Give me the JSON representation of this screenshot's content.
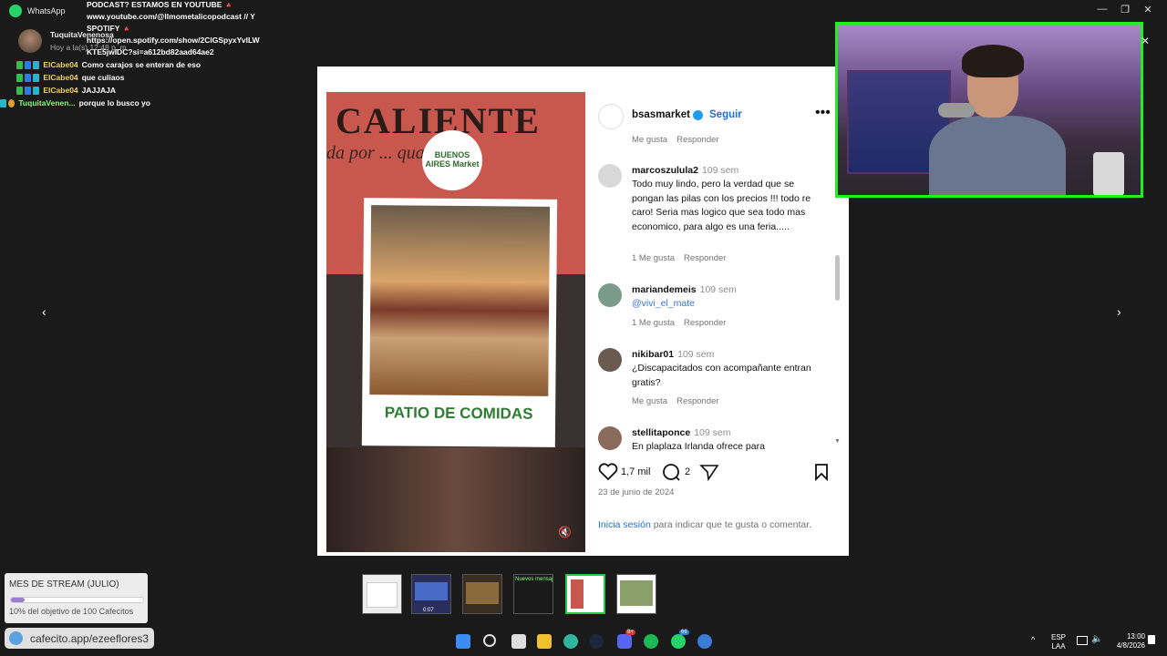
{
  "window": {
    "title": "WhatsApp",
    "minimize": "—",
    "restore": "❐",
    "close": "✕"
  },
  "overlay_top": {
    "line1": "PODCAST? ESTAMOS EN YOUTUBE 🔺",
    "line2": "www.youtube.com/@llmometalicopodcast // Y",
    "line3": "SPOTIFY 🔺",
    "line4": "https://open.spotify.com/show/2ClGSpyxYvlLW",
    "line5": "KTE5jwIDC?si=a612bd82aad64ae2",
    "contact_name": "TuquitaVenenosa",
    "contact_time": "Hoy a la(s) 12:48 p. m."
  },
  "chat": [
    {
      "user": "ElCabe04",
      "text": "Como carajos se enteran de eso"
    },
    {
      "user": "ElCabe04",
      "text": "que culiaos"
    },
    {
      "user": "ElCabe04",
      "text": "JAJJAJA"
    },
    {
      "user": "TuquitaVenen...",
      "text": "porque lo busco yo"
    }
  ],
  "post": {
    "image_heading": "CALIENTE",
    "image_sub": "da por ... qualable c",
    "logo_text": "BUENOS AIRES Market",
    "caption": "PATIO DE COMIDAS",
    "mute_icon": "🔇"
  },
  "header": {
    "user": "bsasmarket",
    "follow": "Seguir",
    "more": "•••"
  },
  "top_partial": {
    "likes": "Me gusta",
    "reply": "Responder"
  },
  "comments": [
    {
      "user": "marcoszulula2",
      "time": "109 sem",
      "text": "Todo muy lindo, pero la verdad que se pongan las pilas con los precios !!! todo re caro! Seria mas logico que sea todo mas economico, para algo es una feria.....",
      "likes": "1 Me gusta",
      "reply": "Responder"
    },
    {
      "user": "mariandemeis",
      "time": "109 sem",
      "text": "@vivi_el_mate",
      "likes": "1 Me gusta",
      "reply": "Responder"
    },
    {
      "user": "nikibar01",
      "time": "109 sem",
      "text": "¿Discapacitados con acompañante entran gratis?",
      "likes": "Me gusta",
      "reply": "Responder"
    },
    {
      "user": "stellitaponce",
      "time": "109 sem",
      "text": "En plaplaza Irlanda ofrece para",
      "likes": "",
      "reply": ""
    }
  ],
  "actions": {
    "likes": "1,7 mil",
    "comments": "2",
    "date": "23 de junio de 2024"
  },
  "login": {
    "link": "Inicia sesión",
    "rest": " para indicar que te gusta o comentar."
  },
  "nav": {
    "prev": "‹",
    "next": "›"
  },
  "goal": {
    "title": "MES DE STREAM (JULIO)",
    "text": "10% del objetivo de 100 Cafecitos",
    "progress": 0.1,
    "fill_color": "#9b7dd4"
  },
  "cafecito": {
    "text": "cafecito.app/ezeeflores3"
  },
  "thumbs": [
    {
      "label": ""
    },
    {
      "label": "0:07"
    },
    {
      "label": ""
    },
    {
      "label": "Nuevos mensaj"
    },
    {
      "label": ""
    },
    {
      "label": ""
    }
  ],
  "taskbar": {
    "discord_badge": "9+",
    "whatsapp_badge": "66",
    "lang1": "ESP",
    "lang2": "LAA",
    "time": "13:00",
    "date": "4/8/2026",
    "caret": "^"
  },
  "colors": {
    "webcam_border": "#22ee22",
    "link_blue": "#1d6fd6",
    "chat_user": "#f2d25c"
  }
}
